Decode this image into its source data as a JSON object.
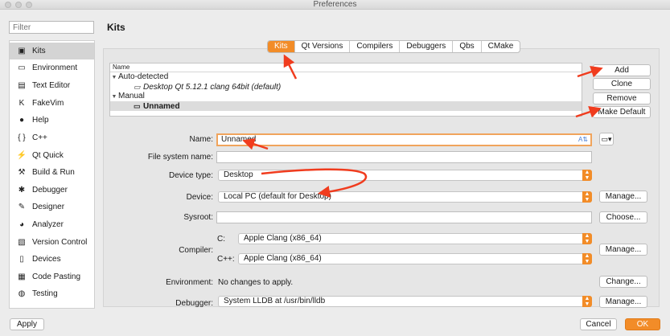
{
  "window": {
    "title": "Preferences"
  },
  "sidebar": {
    "filter_placeholder": "Filter",
    "items": [
      {
        "label": "Kits",
        "icon": "kits-icon",
        "glyph": "▣"
      },
      {
        "label": "Environment",
        "icon": "monitor-icon",
        "glyph": "▭"
      },
      {
        "label": "Text Editor",
        "icon": "text-editor-icon",
        "glyph": "▤"
      },
      {
        "label": "FakeVim",
        "icon": "fakevim-icon",
        "glyph": "K"
      },
      {
        "label": "Help",
        "icon": "help-icon",
        "glyph": "●"
      },
      {
        "label": "C++",
        "icon": "cpp-braces-icon",
        "glyph": "{ }"
      },
      {
        "label": "Qt Quick",
        "icon": "qt-quick-icon",
        "glyph": "⚡"
      },
      {
        "label": "Build & Run",
        "icon": "hammer-icon",
        "glyph": "⚒"
      },
      {
        "label": "Debugger",
        "icon": "bug-icon",
        "glyph": "✱"
      },
      {
        "label": "Designer",
        "icon": "pencil-icon",
        "glyph": "✎"
      },
      {
        "label": "Analyzer",
        "icon": "analyzer-icon",
        "glyph": "◕"
      },
      {
        "label": "Version Control",
        "icon": "version-control-icon",
        "glyph": "▧"
      },
      {
        "label": "Devices",
        "icon": "devices-icon",
        "glyph": "▯"
      },
      {
        "label": "Code Pasting",
        "icon": "code-pasting-icon",
        "glyph": "▦"
      },
      {
        "label": "Testing",
        "icon": "testing-icon",
        "glyph": "◍"
      }
    ],
    "selected": "Kits"
  },
  "page_title": "Kits",
  "tabs": [
    "Kits",
    "Qt Versions",
    "Compilers",
    "Debuggers",
    "Qbs",
    "CMake"
  ],
  "active_tab": "Kits",
  "kit_tree": {
    "column_header": "Name",
    "auto_group": "Auto-detected",
    "auto_kit": "Desktop Qt 5.12.1 clang 64bit (default)",
    "manual_group": "Manual",
    "manual_kit": "Unnamed"
  },
  "kit_buttons": {
    "add": "Add",
    "clone": "Clone",
    "remove": "Remove",
    "make_default": "Make Default"
  },
  "form": {
    "name": {
      "label": "Name:",
      "value": "Unnamed"
    },
    "file_system_name": {
      "label": "File system name:",
      "value": ""
    },
    "device_type": {
      "label": "Device type:",
      "value": "Desktop"
    },
    "device": {
      "label": "Device:",
      "value": "Local PC (default for Desktop)",
      "button": "Manage..."
    },
    "sysroot": {
      "label": "Sysroot:",
      "value": "",
      "button": "Choose..."
    },
    "compiler": {
      "label": "Compiler:",
      "c_label": "C:",
      "c_value": "Apple Clang (x86_64)",
      "cpp_label": "C++:",
      "cpp_value": "Apple Clang (x86_64)",
      "button": "Manage..."
    },
    "environment": {
      "label": "Environment:",
      "value": "No changes to apply.",
      "button": "Change..."
    },
    "debugger": {
      "label": "Debugger:",
      "value": "System LLDB at /usr/bin/lldb",
      "button": "Manage..."
    }
  },
  "footer": {
    "apply": "Apply",
    "cancel": "Cancel",
    "ok": "OK"
  },
  "colors": {
    "accent": "#f28c28",
    "annotation_arrow": "#f03c1e"
  }
}
